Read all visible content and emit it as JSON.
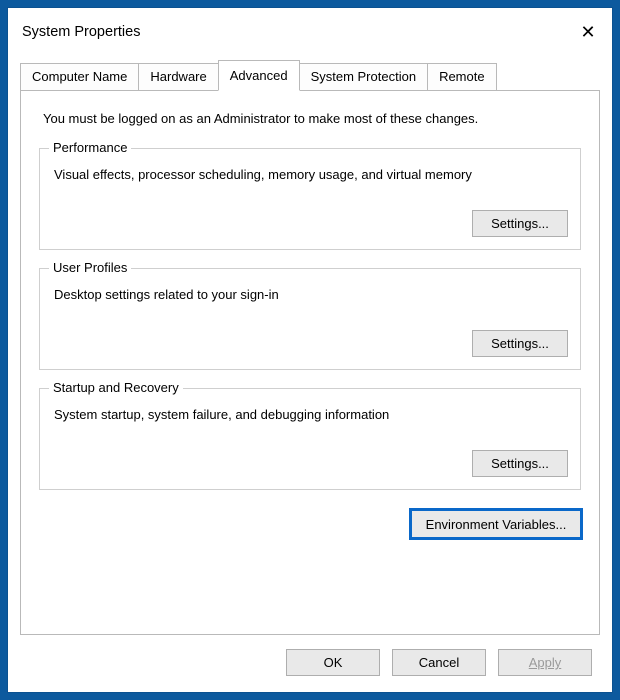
{
  "window": {
    "title": "System Properties"
  },
  "tabs": {
    "computer_name": "Computer Name",
    "hardware": "Hardware",
    "advanced": "Advanced",
    "system_protection": "System Protection",
    "remote": "Remote"
  },
  "advanced_panel": {
    "intro": "You must be logged on as an Administrator to make most of these changes.",
    "performance": {
      "legend": "Performance",
      "desc": "Visual effects, processor scheduling, memory usage, and virtual memory",
      "settings_label": "Settings..."
    },
    "user_profiles": {
      "legend": "User Profiles",
      "desc": "Desktop settings related to your sign-in",
      "settings_label": "Settings..."
    },
    "startup_recovery": {
      "legend": "Startup and Recovery",
      "desc": "System startup, system failure, and debugging information",
      "settings_label": "Settings..."
    },
    "environment_variables_label": "Environment Variables..."
  },
  "dialog_buttons": {
    "ok": "OK",
    "cancel": "Cancel",
    "apply": "Apply"
  }
}
